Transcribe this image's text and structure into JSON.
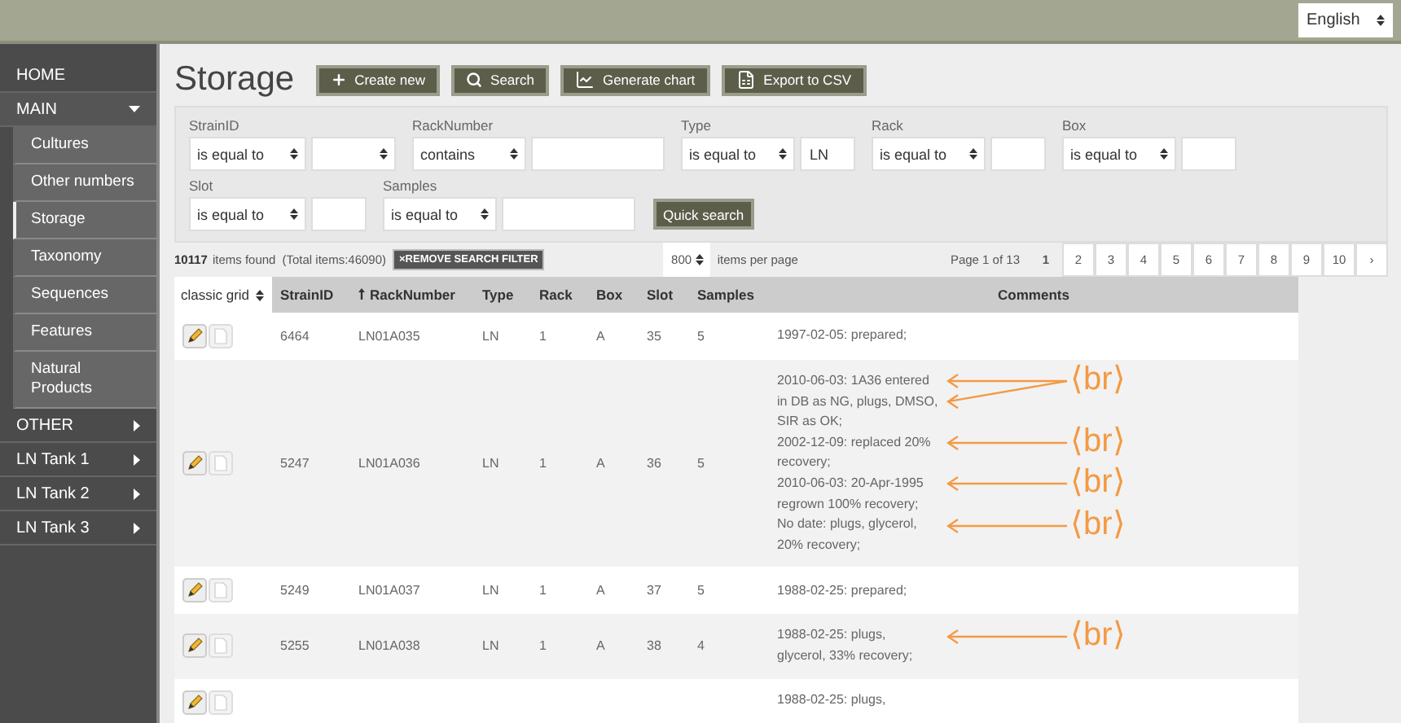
{
  "language": {
    "value": "English"
  },
  "sidebar": {
    "items": [
      {
        "label": "HOME",
        "kind": "top"
      },
      {
        "label": "MAIN",
        "kind": "section",
        "expanded": true,
        "children": [
          {
            "label": "Cultures",
            "selected": false
          },
          {
            "label": "Other numbers",
            "selected": false
          },
          {
            "label": "Storage",
            "selected": true
          },
          {
            "label": "Taxonomy",
            "selected": false
          },
          {
            "label": "Sequences",
            "selected": false
          },
          {
            "label": "Features",
            "selected": false
          },
          {
            "label": "Natural Products",
            "selected": false
          }
        ]
      },
      {
        "label": "OTHER",
        "kind": "section",
        "expanded": false
      },
      {
        "label": "LN Tank 1",
        "kind": "section",
        "expanded": false
      },
      {
        "label": "LN Tank 2",
        "kind": "section",
        "expanded": false
      },
      {
        "label": "LN Tank 3",
        "kind": "section",
        "expanded": false
      }
    ]
  },
  "page_title": "Storage",
  "toolbar": [
    {
      "label": "Create new",
      "kind": "create"
    },
    {
      "label": "Search",
      "kind": "search"
    },
    {
      "label": "Generate chart",
      "kind": "chart"
    },
    {
      "label": "Export to CSV",
      "kind": "export"
    }
  ],
  "filters": [
    {
      "label": "StrainID",
      "operator": "is equal to",
      "kind": "select"
    },
    {
      "label": "RackNumber",
      "operator": "contains",
      "kind": "input"
    },
    {
      "label": "Type",
      "operator": "is equal to",
      "kind": "input",
      "value": "LN"
    },
    {
      "label": "Rack",
      "operator": "is equal to",
      "kind": "input"
    },
    {
      "label": "Box",
      "operator": "is equal to",
      "kind": "input"
    },
    {
      "label": "Slot",
      "operator": "is equal to",
      "kind": "input"
    },
    {
      "label": "Samples",
      "operator": "is equal to",
      "kind": "input"
    }
  ],
  "quick_search": "Quick search",
  "results": {
    "count": "10117",
    "found_text": "items found",
    "total_text": "(Total items:46090)",
    "remove_filter": "×REMOVE SEARCH FILTER",
    "per_page": "800",
    "per_page_label": "items per page"
  },
  "pagination": {
    "label": "Page 1 of 13",
    "pages": [
      {
        "label": "1",
        "selected": true
      },
      {
        "label": "2",
        "selected": false
      },
      {
        "label": "3",
        "selected": false
      },
      {
        "label": "4",
        "selected": false
      },
      {
        "label": "5",
        "selected": false
      },
      {
        "label": "6",
        "selected": false
      },
      {
        "label": "7",
        "selected": false
      },
      {
        "label": "8",
        "selected": false
      },
      {
        "label": "9",
        "selected": false
      },
      {
        "label": "10",
        "selected": false
      }
    ],
    "next": "›"
  },
  "table": {
    "view": "classic grid",
    "columns": [
      {
        "label": "StrainID",
        "sorted": false
      },
      {
        "label": "RackNumber",
        "sorted": true
      },
      {
        "label": "Type",
        "sorted": false
      },
      {
        "label": "Rack",
        "sorted": false
      },
      {
        "label": "Box",
        "sorted": false
      },
      {
        "label": "Slot",
        "sorted": false
      },
      {
        "label": "Samples",
        "sorted": false
      },
      {
        "label": "Comments",
        "sorted": false
      }
    ],
    "rows": [
      {
        "cells": [
          "6464",
          "LN01A035",
          "LN",
          "1",
          "A",
          "35",
          "5"
        ],
        "comment": [
          {
            "text": "1997-02-05: prepared;",
            "arrow": false
          }
        ]
      },
      {
        "cells": [
          "5247",
          "LN01A036",
          "LN",
          "1",
          "A",
          "36",
          "5"
        ],
        "comment": [
          {
            "text": "2010-06-03: 1A36 entered",
            "arrow": true,
            "label": "⟨br⟩"
          },
          {
            "text": "in DB as NG, plugs, DMSO,",
            "arrow": true
          },
          {
            "text": "SIR as OK;",
            "arrow": false
          },
          {
            "text": "2002-12-09: replaced 20%",
            "arrow": true,
            "label": "⟨br⟩"
          },
          {
            "text": "recovery;",
            "arrow": false
          },
          {
            "text": "2010-06-03: 20-Apr-1995",
            "arrow": true,
            "label": "⟨br⟩"
          },
          {
            "text": "regrown 100% recovery;",
            "arrow": false
          },
          {
            "text": "No date: plugs, glycerol,",
            "arrow": true,
            "label": "⟨br⟩"
          },
          {
            "text": "20% recovery;",
            "arrow": false
          }
        ]
      },
      {
        "cells": [
          "5249",
          "LN01A037",
          "LN",
          "1",
          "A",
          "37",
          "5"
        ],
        "comment": [
          {
            "text": "1988-02-25: prepared;",
            "arrow": false
          }
        ]
      },
      {
        "cells": [
          "5255",
          "LN01A038",
          "LN",
          "1",
          "A",
          "38",
          "4"
        ],
        "comment": [
          {
            "text": "1988-02-25: plugs,",
            "arrow": true,
            "label": "⟨br⟩"
          },
          {
            "text": "glycerol, 33% recovery;",
            "arrow": false
          }
        ]
      },
      {
        "cells": [],
        "comment": [
          {
            "text": "1988-02-25: plugs,",
            "arrow": false
          }
        ]
      }
    ]
  }
}
